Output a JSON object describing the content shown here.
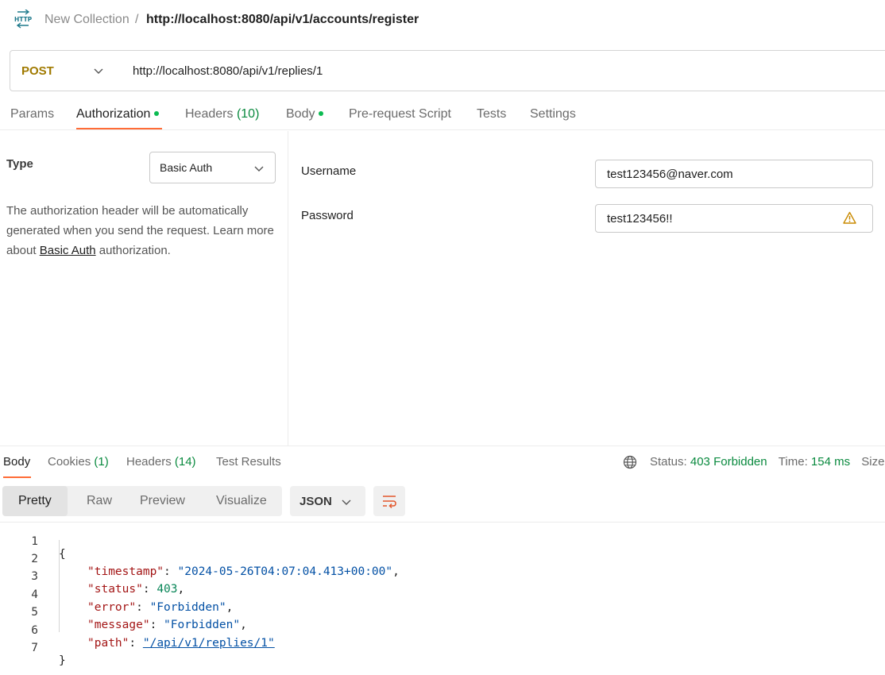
{
  "breadcrumb": {
    "icon": "http-icon",
    "collection": "New Collection",
    "separator": "/",
    "request_name": "http://localhost:8080/api/v1/accounts/register"
  },
  "request": {
    "method": "POST",
    "url": "http://localhost:8080/api/v1/replies/1"
  },
  "request_tabs": [
    {
      "label": "Params"
    },
    {
      "label": "Authorization",
      "dot": true,
      "active": true
    },
    {
      "label": "Headers",
      "count": "(10)"
    },
    {
      "label": "Body",
      "dot": true
    },
    {
      "label": "Pre-request Script"
    },
    {
      "label": "Tests"
    },
    {
      "label": "Settings"
    }
  ],
  "auth": {
    "type_label": "Type",
    "type_value": "Basic Auth",
    "description_before": "The authorization header will be automatically generated when you send the request. Learn more about ",
    "description_link": "Basic Auth",
    "description_after": " authorization.",
    "username_label": "Username",
    "username_value": "test123456@naver.com",
    "password_label": "Password",
    "password_value": "test123456!!"
  },
  "response_tabs": [
    {
      "label": "Body",
      "active": true
    },
    {
      "label": "Cookies",
      "count": "(1)"
    },
    {
      "label": "Headers",
      "count": "(14)"
    },
    {
      "label": "Test Results"
    }
  ],
  "response_status": {
    "status_label": "Status:",
    "status_value": "403 Forbidden",
    "time_label": "Time:",
    "time_value": "154 ms",
    "size_label": "Size:"
  },
  "view_modes": [
    "Pretty",
    "Raw",
    "Preview",
    "Visualize"
  ],
  "active_view": "Pretty",
  "format": "JSON",
  "colors": {
    "accent": "#ff6c37",
    "method_post": "#a07a00",
    "success_green": "#0a8a3f",
    "dot_green": "#0cbb52"
  },
  "response_body": {
    "line_numbers": [
      "1",
      "2",
      "3",
      "4",
      "5",
      "6",
      "7"
    ],
    "open_brace": "{",
    "close_brace": "}",
    "entries": [
      {
        "key": "\"timestamp\"",
        "value": "\"2024-05-26T04:07:04.413+00:00\"",
        "kind": "str",
        "comma": ","
      },
      {
        "key": "\"status\"",
        "value": "403",
        "kind": "num",
        "comma": ","
      },
      {
        "key": "\"error\"",
        "value": "\"Forbidden\"",
        "kind": "str",
        "comma": ","
      },
      {
        "key": "\"message\"",
        "value": "\"Forbidden\"",
        "kind": "str",
        "comma": ","
      },
      {
        "key": "\"path\"",
        "value": "\"/api/v1/replies/1\"",
        "kind": "link",
        "comma": ""
      }
    ]
  }
}
